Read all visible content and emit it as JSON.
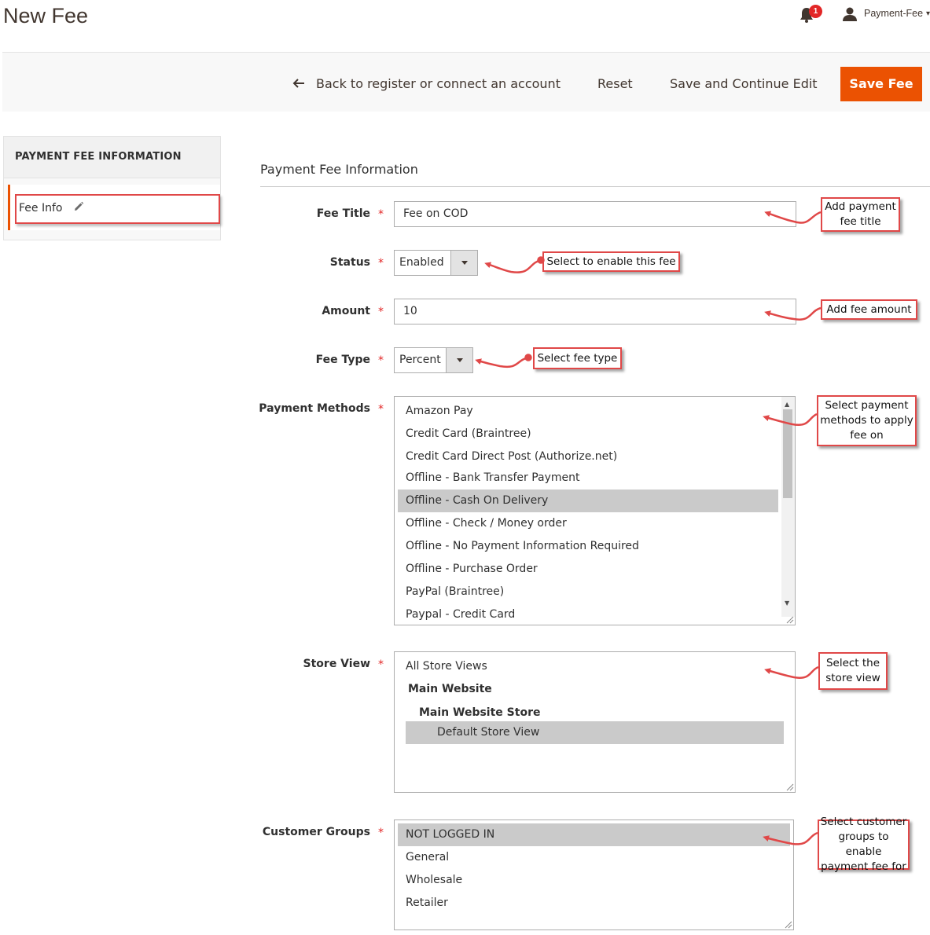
{
  "header": {
    "title": "New Fee",
    "notification_count": "1",
    "user_name": "Payment-Fee"
  },
  "actions": {
    "back_label": "Back to register or connect an account",
    "reset_label": "Reset",
    "save_continue_label": "Save and Continue Edit",
    "save_label": "Save Fee"
  },
  "sidebar": {
    "section_title": "PAYMENT FEE INFORMATION",
    "items": [
      {
        "label": "Fee Info",
        "icon": "pencil-icon"
      }
    ]
  },
  "form": {
    "fieldset_title": "Payment Fee Information",
    "fee_title": {
      "label": "Fee Title",
      "value": "Fee on COD"
    },
    "status": {
      "label": "Status",
      "value": "Enabled"
    },
    "amount": {
      "label": "Amount",
      "value": "10"
    },
    "fee_type": {
      "label": "Fee Type",
      "value": "Percent"
    },
    "payment_methods": {
      "label": "Payment Methods",
      "options": [
        "Amazon Pay",
        "Credit Card (Braintree)",
        "Credit Card Direct Post (Authorize.net)",
        "Offline - Bank Transfer Payment",
        "Offline - Cash On Delivery",
        "Offline - Check / Money order",
        "Offline - No Payment Information Required",
        "Offline - Purchase Order",
        "PayPal (Braintree)",
        "Paypal - Credit Card"
      ],
      "selected": "Offline - Cash On Delivery"
    },
    "store_view": {
      "label": "Store View",
      "options": [
        "All Store Views",
        "Main Website",
        "Main Website Store",
        "Default Store View"
      ],
      "selected": "Default Store View"
    },
    "customer_groups": {
      "label": "Customer Groups",
      "options": [
        "NOT LOGGED IN",
        "General",
        "Wholesale",
        "Retailer"
      ],
      "selected": "NOT LOGGED IN"
    }
  },
  "annotations": {
    "fee_title": [
      "Add payment",
      "fee title"
    ],
    "status": "Select to enable this fee",
    "amount": "Add fee amount",
    "fee_type": "Select fee type",
    "payment_methods": [
      "Select payment",
      "methods to apply",
      "fee on"
    ],
    "store_view": [
      "Select the",
      "store view"
    ],
    "customer_groups": [
      "Select customer",
      "groups to enable",
      "payment fee for"
    ]
  },
  "colors": {
    "accent": "#eb5202",
    "required": "#e22626",
    "annotation_border": "#e04848",
    "selected_option": "#cacaca"
  }
}
